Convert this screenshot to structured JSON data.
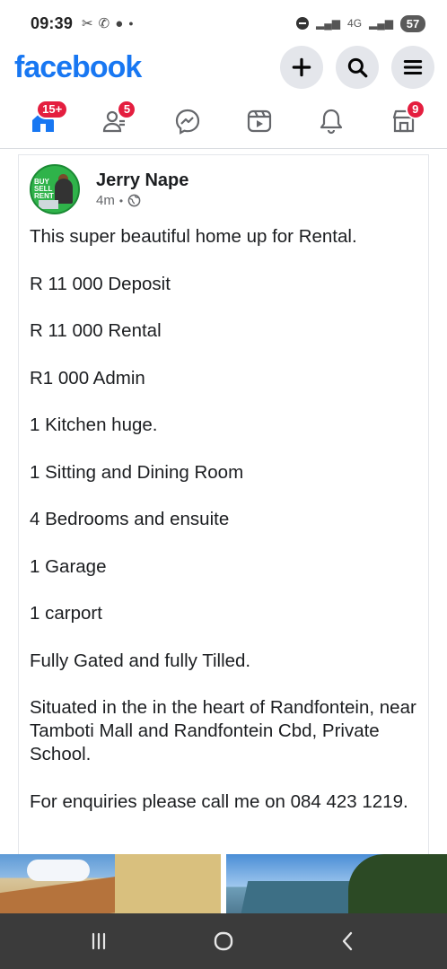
{
  "status_bar": {
    "time": "09:39",
    "left_icons": [
      "missed-call-icon",
      "whatsapp-icon",
      "chat-icon",
      "dot-icon"
    ],
    "signal_text": "4G",
    "battery": "57"
  },
  "header": {
    "logo": "facebook",
    "actions": [
      "add-icon",
      "search-icon",
      "menu-icon"
    ]
  },
  "nav_tabs": [
    {
      "name": "home",
      "icon": "home-icon",
      "badge": "15+",
      "active": true
    },
    {
      "name": "friends",
      "icon": "friends-icon",
      "badge": "5"
    },
    {
      "name": "messenger",
      "icon": "messenger-icon",
      "badge": ""
    },
    {
      "name": "video",
      "icon": "video-icon",
      "badge": ""
    },
    {
      "name": "notifications",
      "icon": "bell-icon",
      "badge": ""
    },
    {
      "name": "marketplace",
      "icon": "marketplace-icon",
      "badge": "9"
    }
  ],
  "post": {
    "author": "Jerry Nape",
    "time": "4m",
    "avatar_text": "BUY SELL RENT",
    "body": [
      "This super beautiful home up for Rental.",
      "R 11 000 Deposit",
      "R 11 000 Rental",
      "R1 000 Admin",
      "1 Kitchen huge.",
      "1 Sitting and Dining Room",
      "4 Bedrooms and ensuite",
      "1 Garage",
      "1 carport",
      "Fully Gated and fully Tilled.",
      "Situated in the in the heart of Randfontein, near Tamboti Mall and Randfontein Cbd, Private School.",
      "For enquiries please call me on 084 423 1219."
    ]
  },
  "colors": {
    "brand": "#1877f2",
    "badge": "#e41e3f",
    "nav_bar": "#3b3b3b"
  }
}
